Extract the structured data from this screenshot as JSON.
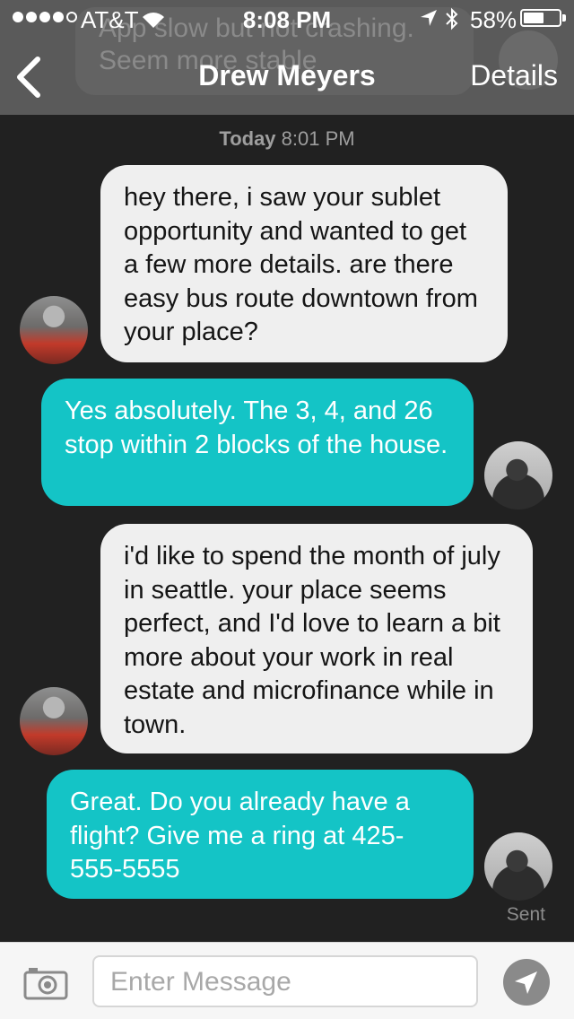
{
  "status_bar": {
    "carrier": "AT&T",
    "time": "8:08 PM",
    "battery_percent": "58%",
    "battery_level": 0.58
  },
  "ghost_notification": {
    "text": "App slow but not crashing.\nSeem more stable"
  },
  "nav": {
    "title": "Drew Meyers",
    "details_label": "Details",
    "back_icon": "chevron-left-icon"
  },
  "conversation": {
    "date_label": "Today",
    "time_label": "8:01 PM",
    "messages": [
      {
        "direction": "incoming",
        "text": "hey there, i saw your sublet opportunity and wanted to get a few more details. are there easy bus route downtown from your place?"
      },
      {
        "direction": "outgoing",
        "text": "Yes absolutely. The 3, 4, and 26 stop within 2 blocks of the house."
      },
      {
        "direction": "incoming",
        "text": "i'd like to spend the month of july in seattle. your place seems perfect, and I'd love to learn a bit more about your work in real estate and microfinance while in town."
      },
      {
        "direction": "outgoing",
        "text": "Great. Do you already have a flight? Give me a ring at 425-555-5555"
      }
    ],
    "delivery_status": "Sent"
  },
  "composer": {
    "placeholder": "Enter Message",
    "camera_icon": "camera-icon",
    "send_icon": "send-icon"
  },
  "colors": {
    "background": "#212121",
    "nav_bar": "#5a5a5a",
    "incoming_bubble": "#efefef",
    "outgoing_bubble": "#14c4c6"
  }
}
